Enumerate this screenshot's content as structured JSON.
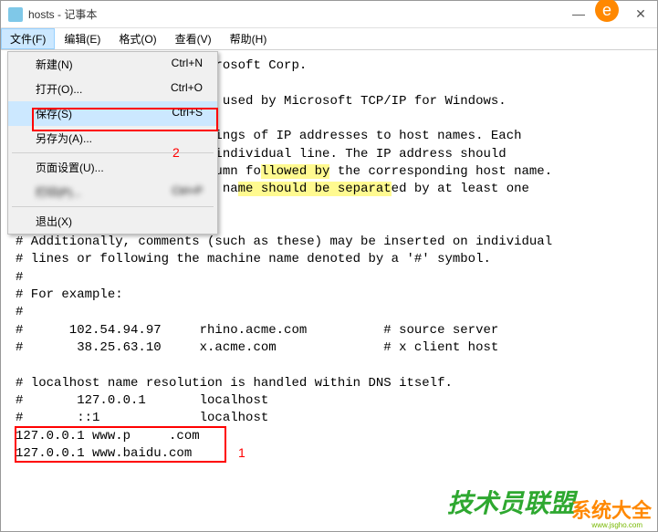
{
  "window": {
    "title": "hosts - 记事本"
  },
  "menubar": {
    "file": "文件(F)",
    "edit": "编辑(E)",
    "format": "格式(O)",
    "view": "查看(V)",
    "help": "帮助(H)"
  },
  "dropdown": {
    "new": {
      "label": "新建(N)",
      "shortcut": "Ctrl+N"
    },
    "open": {
      "label": "打开(O)...",
      "shortcut": "Ctrl+O"
    },
    "save": {
      "label": "保存(S)",
      "shortcut": "Ctrl+S"
    },
    "saveas": {
      "label": "另存为(A)...",
      "shortcut": ""
    },
    "pagesetup": {
      "label": "页面设置(U)...",
      "shortcut": ""
    },
    "print": {
      "label": "打印(P)...",
      "shortcut": "Ctrl+P"
    },
    "exit": {
      "label": "退出(X)",
      "shortcut": ""
    }
  },
  "annot": {
    "one": "1",
    "two": "2"
  },
  "content": {
    "l1": "                       Microsoft Corp.",
    "l2": "#",
    "l3": "                      file used by Microsoft TCP/IP for Windows.",
    "l4": "#",
    "l5": "                      mappings of IP addresses to host names. Each",
    "l6": "                       an individual line. The IP address should",
    "l7a": "                       column fo",
    "l7h": "llowed by",
    "l7b": " the corresponding host name.",
    "l8a": "                      host na",
    "l8h": "me should be separat",
    "l8b": "ed by at least one",
    "l9": "",
    "l10": "",
    "l11": "# Additionally, comments (such as these) may be inserted on individual",
    "l12": "# lines or following the machine name denoted by a '#' symbol.",
    "l13": "#",
    "l14": "# For example:",
    "l15": "#",
    "l16": "#      102.54.94.97     rhino.acme.com          # source server",
    "l17": "#       38.25.63.10     x.acme.com              # x client host",
    "l18": "",
    "l19": "# localhost name resolution is handled within DNS itself.",
    "l20": "#       127.0.0.1       localhost",
    "l21": "#       ::1             localhost",
    "l22": "127.0.0.1 www.p     .com",
    "l23": "127.0.0.1 www.baidu.com"
  },
  "watermark": {
    "w1": "技术员联盟",
    "w2": "系统大全",
    "w3": "www.jsgho.com"
  }
}
